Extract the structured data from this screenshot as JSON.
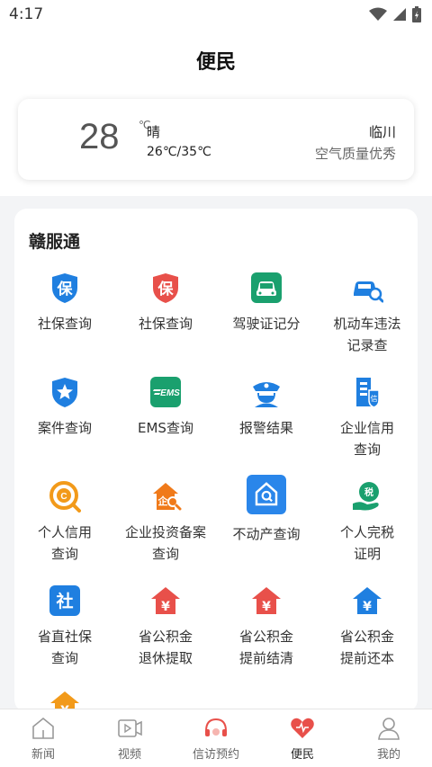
{
  "status_bar": {
    "time": "4:17"
  },
  "header": {
    "title": "便民"
  },
  "weather": {
    "temperature": "28",
    "unit": "℃",
    "condition": "晴",
    "range": "26℃/35℃",
    "city": "临川",
    "air_quality": "空气质量优秀"
  },
  "section": {
    "title": "赣服通",
    "items": [
      {
        "label": "社保查询",
        "icon": "social-security-shield-icon",
        "color": "#1f7fe0"
      },
      {
        "label": "社保查询",
        "icon": "social-security-shield-icon",
        "color": "#e8504a"
      },
      {
        "label": "驾驶证记分",
        "icon": "car-icon",
        "color": "#1aa06e"
      },
      {
        "label": "机动车违法记录查",
        "icon": "car-search-icon",
        "color": "#1f7fe0"
      },
      {
        "label": "案件查询",
        "icon": "star-shield-icon",
        "color": "#1f7fe0"
      },
      {
        "label": "EMS查询",
        "icon": "ems-icon",
        "color": "#1aa06e"
      },
      {
        "label": "报警结果",
        "icon": "police-icon",
        "color": "#1f7fe0"
      },
      {
        "label": "企业信用查询",
        "icon": "building-icon",
        "color": "#1f7fe0"
      },
      {
        "label": "个人信用查询",
        "icon": "credit-icon",
        "color": "#f29a1a"
      },
      {
        "label": "企业投资备案查询",
        "icon": "investment-icon",
        "color": "#f07a1a"
      },
      {
        "label": "不动产查询",
        "icon": "house-search-icon",
        "color": "#1f7fe0"
      },
      {
        "label": "个人完税证明",
        "icon": "tax-icon",
        "color": "#1aa06e"
      },
      {
        "label": "省直社保查询",
        "icon": "social-icon",
        "color": "#1f7fe0"
      },
      {
        "label": "省公积金退休提取",
        "icon": "yuan-house-icon",
        "color": "#e8504a"
      },
      {
        "label": "省公积金提前结清",
        "icon": "yuan-house-icon",
        "color": "#e8504a"
      },
      {
        "label": "省公积金提前还本",
        "icon": "yuan-house-icon",
        "color": "#1f7fe0"
      }
    ]
  },
  "tabs": [
    {
      "label": "新闻",
      "icon": "home-icon"
    },
    {
      "label": "视频",
      "icon": "video-icon"
    },
    {
      "label": "信访预约",
      "icon": "petition-icon"
    },
    {
      "label": "便民",
      "icon": "heart-icon",
      "active": true
    },
    {
      "label": "我的",
      "icon": "user-icon"
    }
  ]
}
